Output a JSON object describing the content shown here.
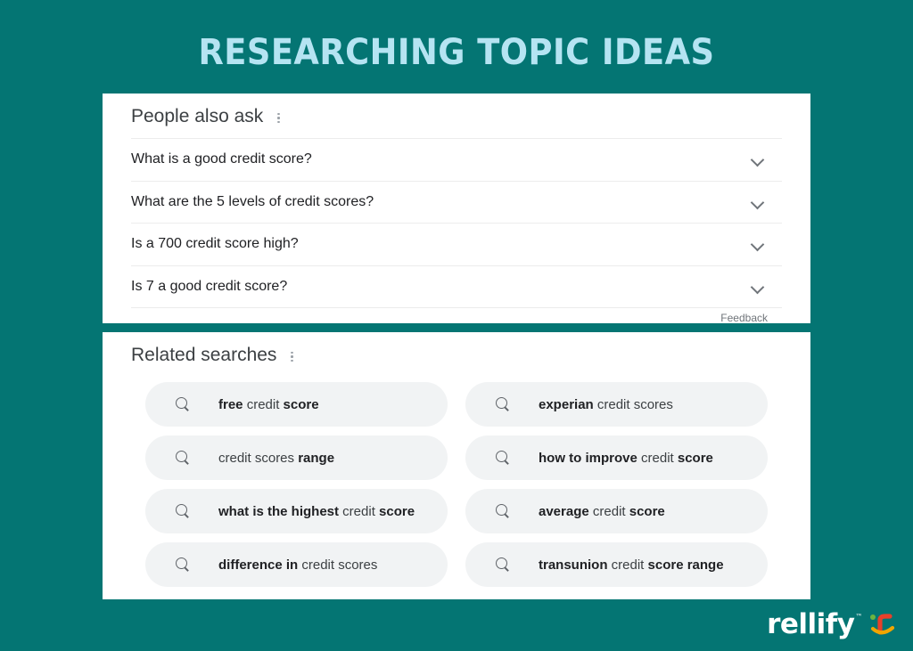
{
  "theme": {
    "background": "#047573",
    "title_color": "#b5e4f2",
    "panel_bg": "#ffffff",
    "chip_bg": "#f1f3f4",
    "text_color": "#202124",
    "muted_color": "#70757a"
  },
  "header": {
    "title": "RESEARCHING TOPIC IDEAS"
  },
  "people_also_ask": {
    "title": "People also ask",
    "menu_icon": "kebab-menu-icon",
    "questions": [
      {
        "text": "What is a good credit score?",
        "icon": "chevron-down-icon"
      },
      {
        "text": "What are the 5 levels of credit scores?",
        "icon": "chevron-down-icon"
      },
      {
        "text": "Is a 700 credit score high?",
        "icon": "chevron-down-icon"
      },
      {
        "text": "Is 7 a good credit score?",
        "icon": "chevron-down-icon"
      }
    ],
    "feedback_label": "Feedback"
  },
  "related_searches": {
    "title": "Related searches",
    "menu_icon": "kebab-menu-icon",
    "search_icon": "search-icon",
    "chips": [
      {
        "full": "free credit score",
        "parts": [
          {
            "t": "free",
            "b": true
          },
          {
            "t": " credit ",
            "b": false
          },
          {
            "t": "score",
            "b": true
          }
        ]
      },
      {
        "full": "experian credit scores",
        "parts": [
          {
            "t": "experian",
            "b": true
          },
          {
            "t": " credit scores",
            "b": false
          }
        ]
      },
      {
        "full": "credit scores range",
        "parts": [
          {
            "t": "credit scores ",
            "b": false
          },
          {
            "t": "range",
            "b": true
          }
        ]
      },
      {
        "full": "how to improve credit score",
        "parts": [
          {
            "t": "how to improve",
            "b": true
          },
          {
            "t": " credit ",
            "b": false
          },
          {
            "t": "score",
            "b": true
          }
        ]
      },
      {
        "full": "what is the highest credit score",
        "parts": [
          {
            "t": "what is the highest",
            "b": true
          },
          {
            "t": " credit ",
            "b": false
          },
          {
            "t": "score",
            "b": true
          }
        ]
      },
      {
        "full": "average credit score",
        "parts": [
          {
            "t": "average",
            "b": true
          },
          {
            "t": " credit ",
            "b": false
          },
          {
            "t": "score",
            "b": true
          }
        ]
      },
      {
        "full": "difference in credit scores",
        "parts": [
          {
            "t": "difference in",
            "b": true
          },
          {
            "t": " credit scores",
            "b": false
          }
        ]
      },
      {
        "full": "transunion credit score range",
        "parts": [
          {
            "t": "transunion",
            "b": true
          },
          {
            "t": " credit ",
            "b": false
          },
          {
            "t": "score range",
            "b": true
          }
        ]
      }
    ]
  },
  "branding": {
    "wordmark": "rellify",
    "trademark": "™",
    "mark_icon": "rellify-logo-icon",
    "mark_colors": {
      "letter": "#e8402a",
      "dot": "#6cb43f",
      "smile": "#f0a500"
    }
  }
}
